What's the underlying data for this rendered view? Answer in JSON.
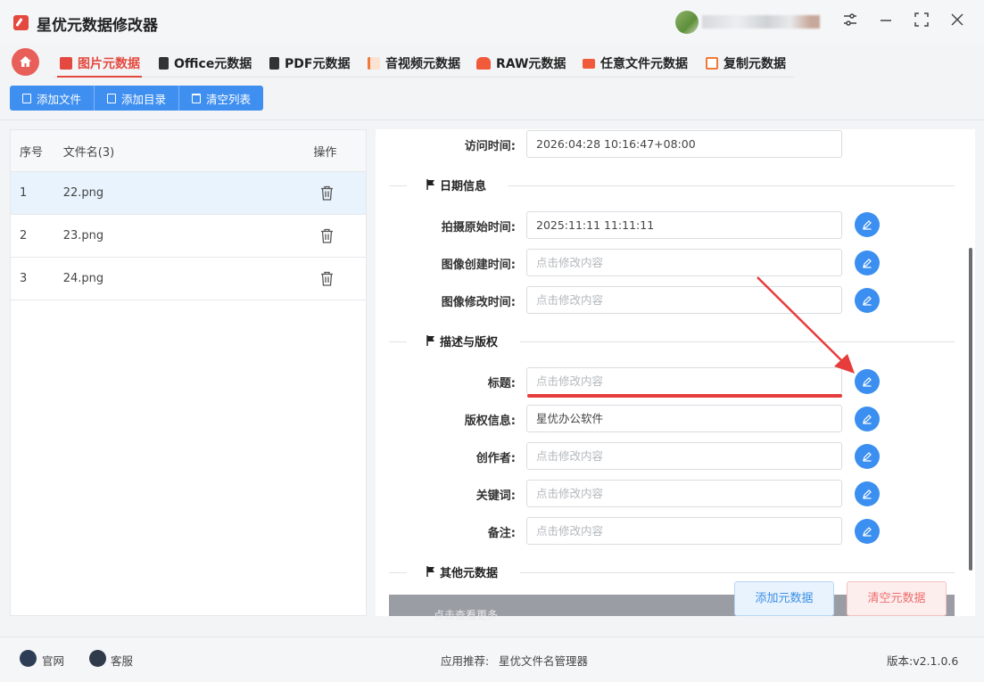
{
  "app": {
    "title": "星优元数据修改器"
  },
  "window_controls": {
    "settings": "⚙",
    "minimize": "—",
    "maximize": "⛶",
    "close": "✕"
  },
  "tabs": [
    {
      "label": "图片元数据",
      "icon": "image-meta-icon",
      "color": "#e4493f"
    },
    {
      "label": "Office元数据",
      "icon": "office-icon",
      "color": "#333333"
    },
    {
      "label": "PDF元数据",
      "icon": "pdf-icon",
      "color": "#333333"
    },
    {
      "label": "音视频元数据",
      "icon": "media-icon",
      "color": "#f07a3a"
    },
    {
      "label": "RAW元数据",
      "icon": "raw-icon",
      "color": "#f05a3a"
    },
    {
      "label": "任意文件元数据",
      "icon": "anyfile-icon",
      "color": "#f05a3a"
    },
    {
      "label": "复制元数据",
      "icon": "copy-meta-icon",
      "color": "#f07a3a"
    }
  ],
  "toolbar": {
    "add_file": "添加文件",
    "add_dir": "添加目录",
    "clear_list": "清空列表"
  },
  "file_table": {
    "headers": {
      "index": "序号",
      "name": "文件名(3)",
      "action": "操作"
    },
    "rows": [
      {
        "index": "1",
        "name": "22.png"
      },
      {
        "index": "2",
        "name": "23.png"
      },
      {
        "index": "3",
        "name": "24.png"
      }
    ]
  },
  "form": {
    "access_time": {
      "label": "访问时间:",
      "value": "2026:04:28 10:16:47+08:00"
    },
    "section_date": "日期信息",
    "shot_time": {
      "label": "拍摄原始时间:",
      "value": "2025:11:11 11:11:11"
    },
    "create_time": {
      "label": "图像创建时间:",
      "placeholder": "点击修改内容"
    },
    "modify_time": {
      "label": "图像修改时间:",
      "placeholder": "点击修改内容"
    },
    "section_desc": "描述与版权",
    "title": {
      "label": "标题:",
      "placeholder": "点击修改内容"
    },
    "copyright": {
      "label": "版权信息:",
      "value": "星优办公软件"
    },
    "author": {
      "label": "创作者:",
      "placeholder": "点击修改内容"
    },
    "keywords": {
      "label": "关键词:",
      "placeholder": "点击修改内容"
    },
    "remark": {
      "label": "备注:",
      "placeholder": "点击修改内容"
    },
    "section_other": "其他元数据",
    "other_hint": "点击查看更多"
  },
  "actions": {
    "add_meta": "添加元数据",
    "clear_meta": "清空元数据"
  },
  "status": {
    "website": "官网",
    "service": "客服",
    "recommend_label": "应用推荐:",
    "recommend_app": "星优文件名管理器",
    "version": "版本:v2.1.0.6"
  }
}
